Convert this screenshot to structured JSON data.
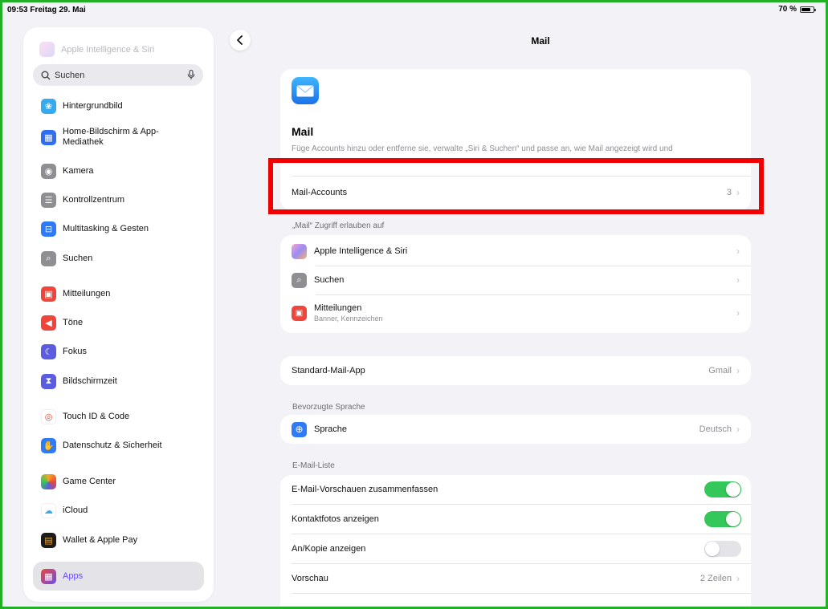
{
  "statusbar": {
    "time": "09:53",
    "date": "Freitag 29. Mai",
    "battery": "70 %"
  },
  "sidebar": {
    "faded_item": "Apple Intelligence & Siri",
    "search_placeholder": "Suchen",
    "items": [
      {
        "label": "Hintergrundbild",
        "icon": "wallpaper-icon",
        "color": "#35aaf0"
      },
      {
        "label": "Home-Bildschirm & App-\nMediathek",
        "icon": "home-screen-icon",
        "color": "#2f6ef0"
      },
      {
        "label": "Kamera",
        "icon": "camera-icon",
        "color": "#8e8e93"
      },
      {
        "label": "Kontrollzentrum",
        "icon": "control-center-icon",
        "color": "#8e8e93"
      },
      {
        "label": "Multitasking & Gesten",
        "icon": "multitasking-icon",
        "color": "#2f7bf5"
      },
      {
        "label": "Suchen",
        "icon": "search-icon",
        "color": "#8e8e93"
      },
      {
        "label": "Mitteilungen",
        "icon": "notifications-icon",
        "color": "#f0453a"
      },
      {
        "label": "Töne",
        "icon": "sounds-icon",
        "color": "#f0453a"
      },
      {
        "label": "Fokus",
        "icon": "focus-icon",
        "color": "#5b5ce0"
      },
      {
        "label": "Bildschirmzeit",
        "icon": "screen-time-icon",
        "color": "#5b5ce0"
      },
      {
        "label": "Touch ID & Code",
        "icon": "fingerprint-icon",
        "color": "#ffffff"
      },
      {
        "label": "Datenschutz & Sicherheit",
        "icon": "privacy-icon",
        "color": "#2f7bf5"
      },
      {
        "label": "Game Center",
        "icon": "game-center-icon",
        "color": "#ffffff"
      },
      {
        "label": "iCloud",
        "icon": "icloud-icon",
        "color": "#ffffff"
      },
      {
        "label": "Wallet & Apple Pay",
        "icon": "wallet-icon",
        "color": "#1c1c1e"
      },
      {
        "label": "Apps",
        "icon": "apps-icon",
        "color": "#6a4cf0",
        "selected": true
      }
    ]
  },
  "header": {
    "title": "Mail"
  },
  "app_card": {
    "name": "Mail",
    "description": "Füge Accounts hinzu oder entferne sie, verwalte „Siri & Suchen“ und passe an, wie Mail angezeigt wird und",
    "accounts_label": "Mail-Accounts",
    "accounts_count": "3"
  },
  "access": {
    "header": "„Mail“ Zugriff erlauben auf",
    "rows": [
      {
        "label": "Apple Intelligence & Siri",
        "sub": ""
      },
      {
        "label": "Suchen",
        "sub": ""
      },
      {
        "label": "Mitteilungen",
        "sub": "Banner, Kennzeichen"
      }
    ]
  },
  "default_app": {
    "label": "Standard-Mail-App",
    "value": "Gmail"
  },
  "language": {
    "header": "Bevorzugte Sprache",
    "label": "Sprache",
    "value": "Deutsch"
  },
  "mail_list": {
    "header": "E-Mail-Liste",
    "rows": [
      {
        "label": "E-Mail-Vorschauen zusammenfassen",
        "toggle": true
      },
      {
        "label": "Kontaktfotos anzeigen",
        "toggle": true
      },
      {
        "label": "An/Kopie anzeigen",
        "toggle": false
      },
      {
        "label": "Vorschau",
        "value": "2 Zeilen"
      }
    ]
  },
  "colors": {
    "accent_green": "#34c759",
    "highlight_red": "#f00000",
    "frame_green": "#22b026"
  }
}
